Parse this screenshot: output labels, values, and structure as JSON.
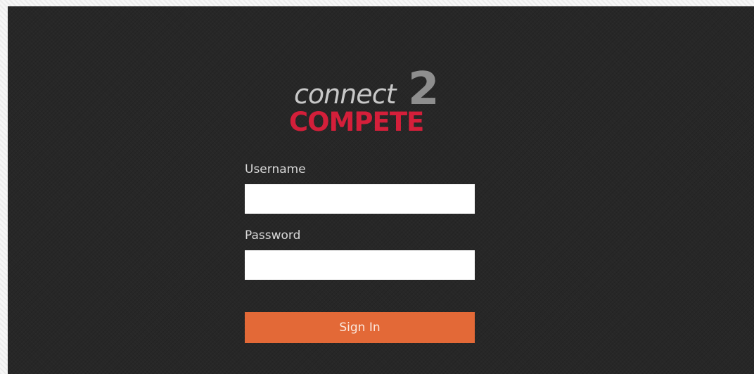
{
  "logo": {
    "connect_text": "connect",
    "two_text": "2",
    "compete_text": "COMPETE"
  },
  "form": {
    "username_label": "Username",
    "username_value": "",
    "password_label": "Password",
    "password_value": "",
    "signin_label": "Sign In"
  },
  "colors": {
    "panel_background": "#272727",
    "button_accent": "#e36937",
    "logo_red": "#d41f3a",
    "logo_gray": "#8e8e8e"
  }
}
